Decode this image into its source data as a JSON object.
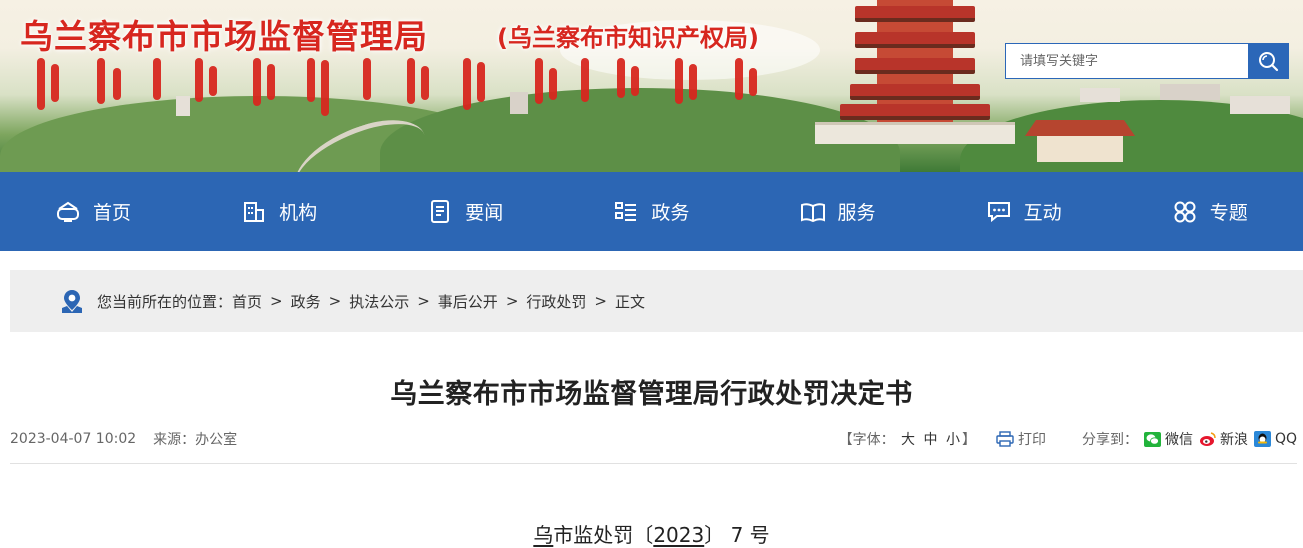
{
  "header": {
    "site_title": "乌兰察布市市场监督管理局",
    "site_subtitle": "(乌兰察布市知识产权局)",
    "search_placeholder": "请填写关键字"
  },
  "nav": {
    "items": [
      {
        "label": "首页",
        "icon": "home-icon"
      },
      {
        "label": "机构",
        "icon": "building-icon"
      },
      {
        "label": "要闻",
        "icon": "document-icon"
      },
      {
        "label": "政务",
        "icon": "list-icon"
      },
      {
        "label": "服务",
        "icon": "book-icon"
      },
      {
        "label": "互动",
        "icon": "chat-icon"
      },
      {
        "label": "专题",
        "icon": "clover-icon"
      }
    ]
  },
  "breadcrumb": {
    "prefix": "您当前所在的位置：",
    "items": [
      "首页",
      "政务",
      "执法公示",
      "事后公开",
      "行政处罚",
      "正文"
    ]
  },
  "article": {
    "title": "乌兰察布市市场监督管理局行政处罚决定书",
    "datetime": "2023-04-07 10:02",
    "source": "来源：办公室",
    "font_label_open": "【字体：",
    "font_large": "大",
    "font_medium": "中",
    "font_small": "小",
    "font_label_close": "】",
    "print_label": "打印",
    "share_label": "分享到：",
    "share_wechat": "微信",
    "share_weibo": "新浪",
    "share_qq": "QQ",
    "doc_no_prefix": "乌",
    "doc_no_mid": "市监处罚〔",
    "doc_no_year": "2023",
    "doc_no_suffix": "〕 7 号"
  },
  "colors": {
    "title_red": "#d7271f",
    "nav_blue": "#2c66b4",
    "breadcrumb_bg": "#eeeeee"
  }
}
